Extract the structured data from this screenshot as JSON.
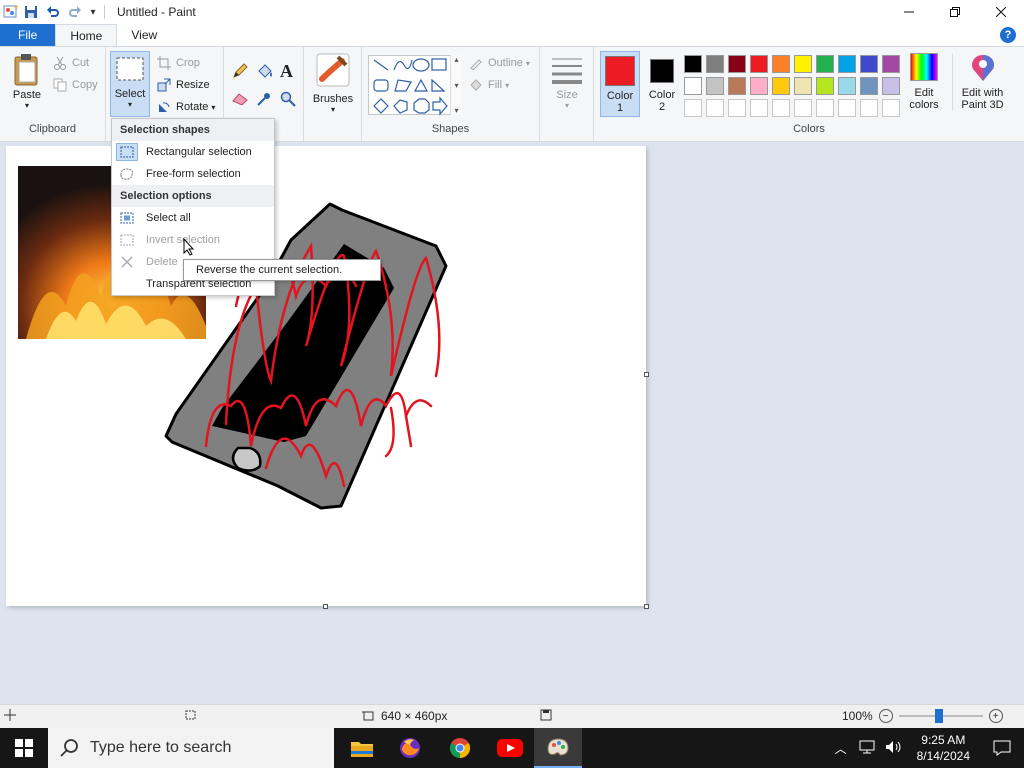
{
  "window": {
    "title": "Untitled - Paint"
  },
  "tabs": {
    "file": "File",
    "home": "Home",
    "view": "View"
  },
  "clipboard": {
    "paste": "Paste",
    "cut": "Cut",
    "copy": "Copy",
    "label": "Clipboard"
  },
  "image": {
    "select": "Select",
    "crop": "Crop",
    "resize": "Resize",
    "rotate": "Rotate"
  },
  "tools": {
    "brushes": "Brushes"
  },
  "shapes": {
    "outline": "Outline",
    "fill": "Fill",
    "label": "Shapes"
  },
  "size": {
    "label": "Size"
  },
  "colors": {
    "color1_line1": "Color",
    "color1_line2": "1",
    "color2_line1": "Color",
    "color2_line2": "2",
    "edit_line1": "Edit",
    "edit_line2": "colors",
    "paint3d_line1": "Edit with",
    "paint3d_line2": "Paint 3D",
    "label": "Colors",
    "color1_value": "#ed1c24",
    "color2_value": "#000000",
    "palette_row1": [
      "#000000",
      "#7f7f7f",
      "#880015",
      "#ed1c24",
      "#ff7f27",
      "#fff200",
      "#22b14c",
      "#00a2e8",
      "#3f48cc",
      "#a349a4"
    ],
    "palette_row2": [
      "#ffffff",
      "#c3c3c3",
      "#b97a57",
      "#ffaec9",
      "#ffc90e",
      "#efe4b0",
      "#b5e61d",
      "#99d9ea",
      "#7092be",
      "#c8bfe7"
    ]
  },
  "menu": {
    "header_shapes": "Selection shapes",
    "rect": "Rectangular selection",
    "freeform": "Free-form selection",
    "header_options": "Selection options",
    "select_all": "Select all",
    "invert": "Invert selection",
    "delete": "Delete",
    "transparent": "Transparent selection"
  },
  "tooltip": {
    "text": "Reverse the current selection."
  },
  "status": {
    "dimensions": "640 × 460px",
    "zoom": "100%"
  },
  "taskbar": {
    "search_placeholder": "Type here to search",
    "time": "9:25 AM",
    "date": "8/14/2024"
  }
}
